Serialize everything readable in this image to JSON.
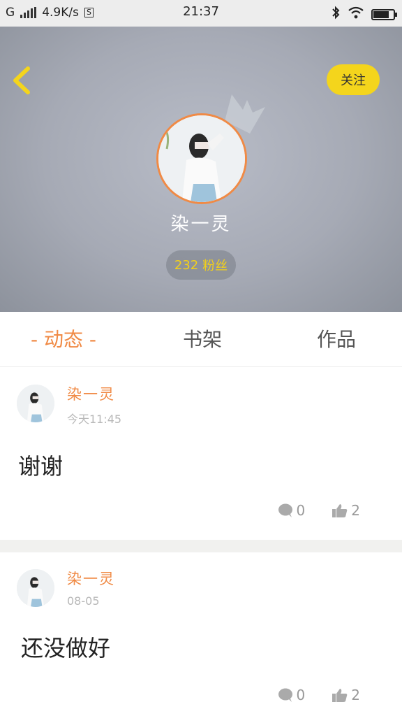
{
  "status_bar": {
    "network": "G",
    "speed": "4.9K/s",
    "sim_icon": "S",
    "time": "21:37",
    "battery_level": 0.85
  },
  "profile": {
    "follow_label": "关注",
    "name": "染一灵",
    "fans_count": "232",
    "fans_label": "粉丝"
  },
  "tabs": [
    {
      "label": "- 动态 -",
      "active": true
    },
    {
      "label": "书架",
      "active": false
    },
    {
      "label": "作品",
      "active": false
    }
  ],
  "posts": [
    {
      "author": "染一灵",
      "time": "今天11:45",
      "text": "谢谢",
      "comments": "0",
      "likes": "2"
    },
    {
      "author": "染一灵",
      "time": "08-05",
      "text": "还没做好",
      "comments": "0",
      "likes": "2"
    }
  ],
  "colors": {
    "accent": "#f08a45",
    "follow_bg": "#f4d51c",
    "fans_text": "#f2d01a"
  },
  "icons": [
    "back-arrow-icon",
    "crown-icon",
    "comment-icon",
    "thumbs-up-icon",
    "bluetooth-icon",
    "wifi-icon",
    "battery-icon",
    "signal-icon"
  ]
}
